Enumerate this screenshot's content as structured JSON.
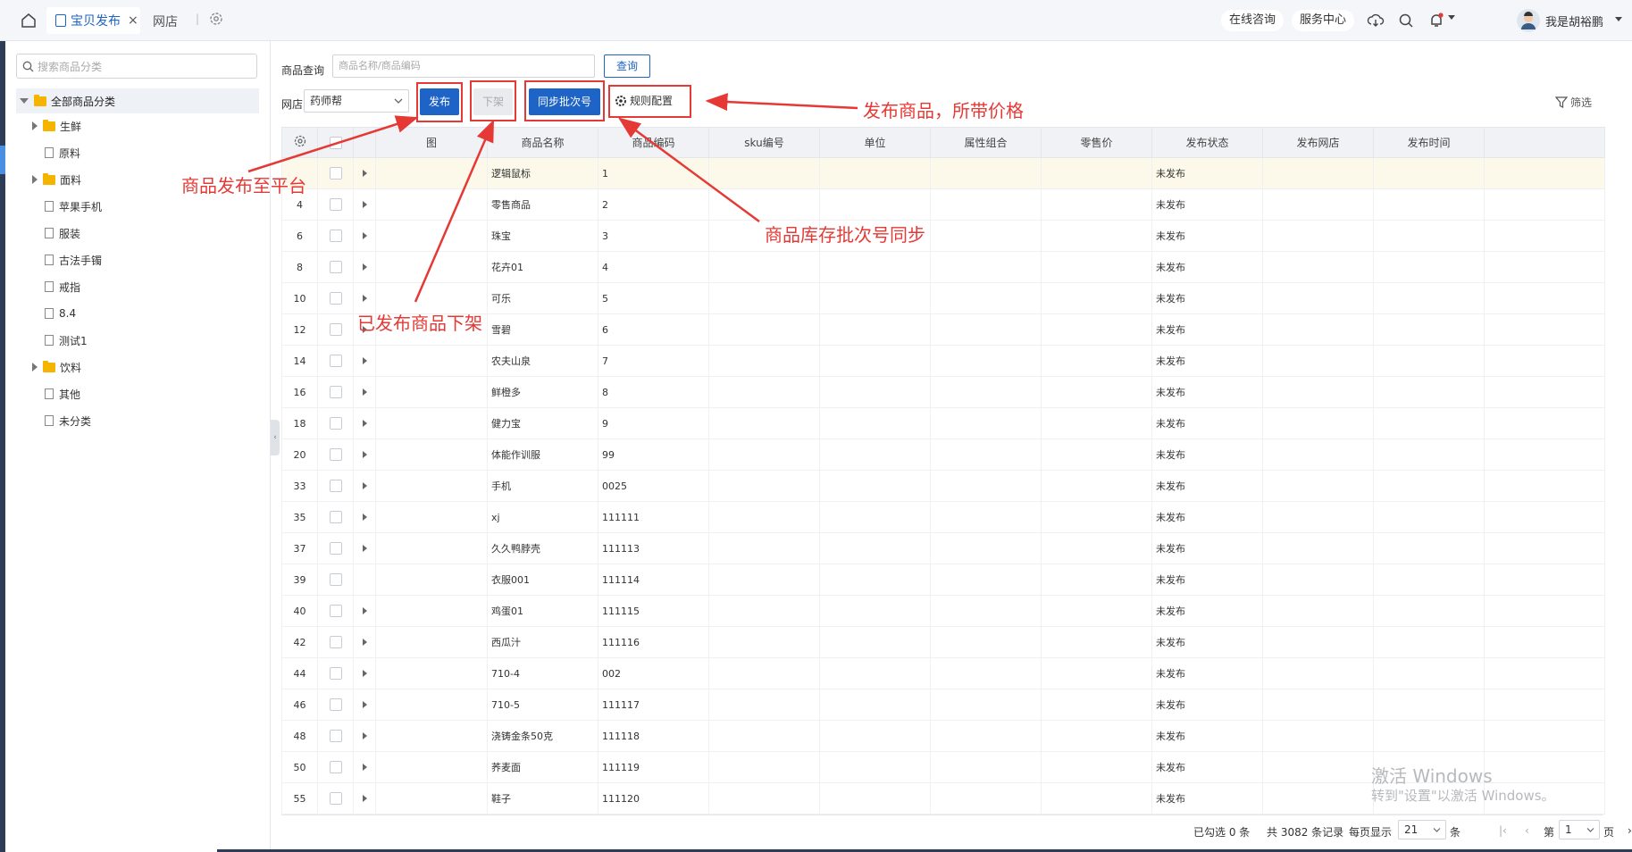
{
  "tabs": {
    "active": "宝贝发布",
    "second": "网店"
  },
  "topbar": {
    "consult": "在线咨询",
    "service": "服务中心",
    "user": "我是胡裕鹏"
  },
  "tree": {
    "search_placeholder": "搜索商品分类",
    "root": "全部商品分类",
    "items": [
      {
        "label": "生鲜",
        "type": "folder"
      },
      {
        "label": "原料",
        "type": "file"
      },
      {
        "label": "面料",
        "type": "folder"
      },
      {
        "label": "苹果手机",
        "type": "file"
      },
      {
        "label": "服装",
        "type": "file"
      },
      {
        "label": "古法手镯",
        "type": "file"
      },
      {
        "label": "戒指",
        "type": "file"
      },
      {
        "label": "8.4",
        "type": "file"
      },
      {
        "label": "测试1",
        "type": "file"
      },
      {
        "label": "饮料",
        "type": "folder"
      },
      {
        "label": "其他",
        "type": "file"
      },
      {
        "label": "未分类",
        "type": "file"
      }
    ]
  },
  "query": {
    "label": "商品查询",
    "placeholder": "商品名称/商品编码",
    "button": "查询"
  },
  "shop": {
    "label": "网店",
    "selected": "药师帮"
  },
  "toolbar": {
    "publish": "发布",
    "unpublish": "下架",
    "sync": "同步批次号",
    "rules": "规则配置",
    "filter": "筛选"
  },
  "annotations": {
    "publish_to_platform": "商品发布至平台",
    "unpublish": "已发布商品下架",
    "publish_price": "发布商品，所带价格",
    "sync_batch": "商品库存批次号同步"
  },
  "table": {
    "headers": [
      "图",
      "商品名称",
      "商品编码",
      "sku编号",
      "单位",
      "属性组合",
      "零售价",
      "发布状态",
      "发布网店",
      "发布时间"
    ],
    "rows": [
      {
        "id": "",
        "name": "逻辑鼠标",
        "code": "1",
        "status": "未发布",
        "arrow": true
      },
      {
        "id": "4",
        "name": "零售商品",
        "code": "2",
        "status": "未发布",
        "arrow": true
      },
      {
        "id": "6",
        "name": "珠宝",
        "code": "3",
        "status": "未发布",
        "arrow": true
      },
      {
        "id": "8",
        "name": "花卉01",
        "code": "4",
        "status": "未发布",
        "arrow": true
      },
      {
        "id": "10",
        "name": "可乐",
        "code": "5",
        "status": "未发布",
        "arrow": true
      },
      {
        "id": "12",
        "name": "雪碧",
        "code": "6",
        "status": "未发布",
        "arrow": true
      },
      {
        "id": "14",
        "name": "农夫山泉",
        "code": "7",
        "status": "未发布",
        "arrow": true
      },
      {
        "id": "16",
        "name": "鲜橙多",
        "code": "8",
        "status": "未发布",
        "arrow": true
      },
      {
        "id": "18",
        "name": "健力宝",
        "code": "9",
        "status": "未发布",
        "arrow": true
      },
      {
        "id": "20",
        "name": "体能作训服",
        "code": "99",
        "status": "未发布",
        "arrow": true
      },
      {
        "id": "33",
        "name": "手机",
        "code": "0025",
        "status": "未发布",
        "arrow": true
      },
      {
        "id": "35",
        "name": "xj",
        "code": "111111",
        "status": "未发布",
        "arrow": true
      },
      {
        "id": "37",
        "name": "久久鸭脖壳",
        "code": "111113",
        "status": "未发布",
        "arrow": true
      },
      {
        "id": "39",
        "name": "衣服001",
        "code": "111114",
        "status": "未发布",
        "arrow": false
      },
      {
        "id": "40",
        "name": "鸡蛋01",
        "code": "111115",
        "status": "未发布",
        "arrow": true
      },
      {
        "id": "42",
        "name": "西瓜汁",
        "code": "111116",
        "status": "未发布",
        "arrow": true
      },
      {
        "id": "44",
        "name": "710-4",
        "code": "002",
        "status": "未发布",
        "arrow": true
      },
      {
        "id": "46",
        "name": "710-5",
        "code": "111117",
        "status": "未发布",
        "arrow": true
      },
      {
        "id": "48",
        "name": "浇铸金条50克",
        "code": "111118",
        "status": "未发布",
        "arrow": true
      },
      {
        "id": "50",
        "name": "荞麦面",
        "code": "111119",
        "status": "未发布",
        "arrow": true
      },
      {
        "id": "55",
        "name": "鞋子",
        "code": "111120",
        "status": "未发布",
        "arrow": true
      }
    ]
  },
  "footer": {
    "selected": "已勾选 0 条",
    "total": "共 3082 条记录",
    "per_page_label": "每页显示",
    "per_page": "21",
    "unit": "条",
    "page_label": "第",
    "page": "1",
    "page_unit": "页"
  },
  "watermark": {
    "line1": "激活 Windows",
    "line2": "转到\"设置\"以激活 Windows。"
  }
}
